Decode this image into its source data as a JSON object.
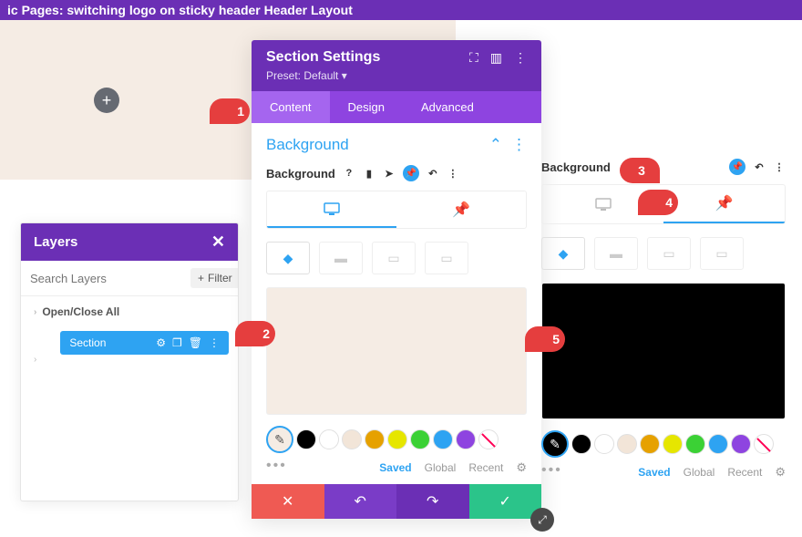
{
  "top_bar": "ic Pages: switching logo on sticky header Header Layout",
  "layers": {
    "title": "Layers",
    "search_placeholder": "Search Layers",
    "filter_label": "Filter",
    "open_close": "Open/Close All",
    "section_label": "Section"
  },
  "settings": {
    "title": "Section Settings",
    "preset": "Preset: Default ▾",
    "tabs": {
      "content": "Content",
      "design": "Design",
      "advanced": "Advanced"
    },
    "bg_heading": "Background",
    "bg_label": "Background",
    "saved": "Saved",
    "global": "Global",
    "recent": "Recent"
  },
  "panel_b": {
    "bg_label": "Background",
    "saved": "Saved",
    "global": "Global",
    "recent": "Recent"
  },
  "colors": {
    "swatch_a": "#f5ece4",
    "swatch_b": "#000000",
    "palette": [
      "#000000",
      "#ffffff",
      "#f2e5d8",
      "#e6a100",
      "#e6e600",
      "#3bd135",
      "#2ea3f2",
      "#8e44e0"
    ]
  },
  "callouts": {
    "1": "1",
    "2": "2",
    "3": "3",
    "4": "4",
    "5": "5"
  }
}
